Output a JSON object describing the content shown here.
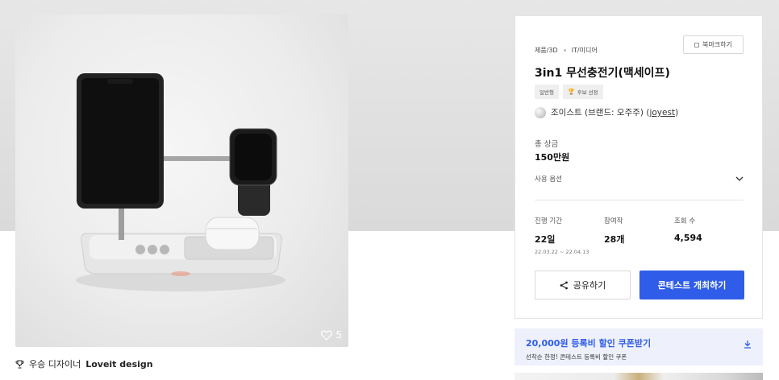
{
  "product": {
    "like_count": "5",
    "designer_prefix": "우승 디자이너",
    "designer_name": "Loveit design"
  },
  "contest": {
    "bookmark_label": "북마크하기",
    "category_1": "제품/3D",
    "category_2": "IT/미디어",
    "title": "3in1 무선충전기(맥세이프)",
    "tag_1": "일반형",
    "tag_2": "후보 선정",
    "host_name": "조이스트 (브랜드: 오주주) (",
    "host_link": "joyest",
    "host_close": ")",
    "prize_label": "총 상금",
    "prize_value": "150만원",
    "usage_label": "사용 옵션",
    "period_label": "진행 기간",
    "period_value": "22일",
    "period_dates": "22.03.22 ~ 22.04.13",
    "participants_label": "참여작",
    "participants_value": "28개",
    "views_label": "조회 수",
    "views_value": "4,594",
    "share_label": "공유하기",
    "host_button_label": "콘테스트 개최하기"
  },
  "coupon": {
    "title": "20,000원 등록비 할인 쿠폰받기",
    "subtitle": "선착순 한정! 콘테스트 등록비 할인 쿠폰"
  },
  "colors": {
    "accent": "#2f5ce8",
    "coupon_bg": "#eef1fb"
  },
  "icons": {
    "heart": "heart-icon",
    "trophy": "trophy-icon",
    "share": "share-icon",
    "chevron": "chevron-down-icon",
    "download": "download-icon"
  }
}
